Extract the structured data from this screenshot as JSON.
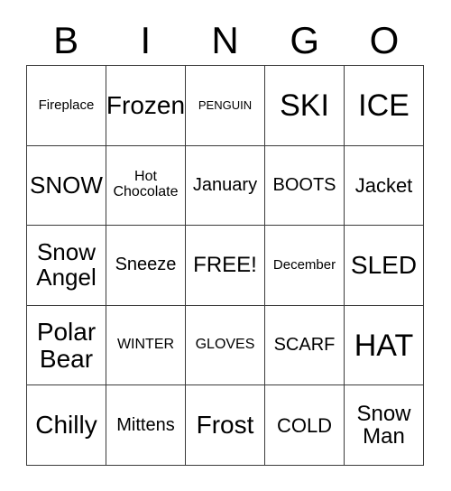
{
  "card": {
    "title_letters": [
      "B",
      "I",
      "N",
      "G",
      "O"
    ],
    "border_color": "#3a3a3a",
    "text_color": "#000000",
    "background_color": "#ffffff",
    "rows": 5,
    "columns": 5,
    "free_space": "FREE!",
    "cells": [
      [
        {
          "text": "Fireplace",
          "size": "sm"
        },
        {
          "text": "Frozen",
          "size": "xxl"
        },
        {
          "text": "PENGUIN",
          "size": "xs"
        },
        {
          "text": "SKI",
          "size": "h2"
        },
        {
          "text": "ICE",
          "size": "h2"
        }
      ],
      [
        {
          "text": "SNOW",
          "size": "xl"
        },
        {
          "text": "Hot\nChocolate",
          "size": "smp"
        },
        {
          "text": "January",
          "size": "mdp"
        },
        {
          "text": "BOOTS",
          "size": "mdp"
        },
        {
          "text": "Jacket",
          "size": "lg"
        }
      ],
      [
        {
          "text": "Snow\nAngel",
          "size": "xl"
        },
        {
          "text": "Sneeze",
          "size": "mdp"
        },
        {
          "text": "FREE!",
          "size": "lgp"
        },
        {
          "text": "December",
          "size": "sm"
        },
        {
          "text": "SLED",
          "size": "xxl"
        }
      ],
      [
        {
          "text": "Polar\nBear",
          "size": "xxl"
        },
        {
          "text": "WINTER",
          "size": "smp"
        },
        {
          "text": "GLOVES",
          "size": "smp"
        },
        {
          "text": "SCARF",
          "size": "mdp"
        },
        {
          "text": "HAT",
          "size": "h2"
        }
      ],
      [
        {
          "text": "Chilly",
          "size": "xxl"
        },
        {
          "text": "Mittens",
          "size": "mdp"
        },
        {
          "text": "Frost",
          "size": "xxl"
        },
        {
          "text": "COLD",
          "size": "lg"
        },
        {
          "text": "Snow\nMan",
          "size": "lgp"
        }
      ]
    ]
  }
}
